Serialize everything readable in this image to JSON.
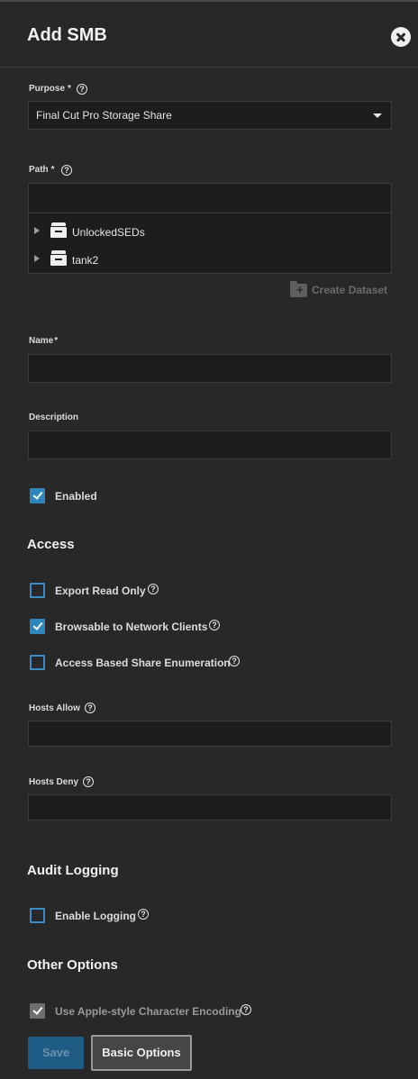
{
  "dialog": {
    "title": "Add SMB"
  },
  "purpose": {
    "label": "Purpose",
    "required_mark": "*",
    "value": "Final Cut Pro Storage Share"
  },
  "path": {
    "label": "Path",
    "required_mark": "*",
    "tree": [
      {
        "name": "UnlockedSEDs",
        "icon": "dataset-icon"
      },
      {
        "name": "tank2",
        "icon": "dataset-icon"
      }
    ],
    "create_dataset_label": "Create Dataset"
  },
  "name": {
    "label": "Name",
    "required_mark": "*",
    "value": ""
  },
  "description": {
    "label": "Description",
    "value": ""
  },
  "enabled": {
    "label": "Enabled",
    "checked": true
  },
  "access": {
    "heading": "Access",
    "export_read_only": {
      "label": "Export Read Only",
      "checked": false
    },
    "browsable": {
      "label": "Browsable to Network Clients",
      "checked": true
    },
    "abe": {
      "label": "Access Based Share Enumeration",
      "checked": false
    },
    "hosts_allow": {
      "label": "Hosts Allow",
      "value": ""
    },
    "hosts_deny": {
      "label": "Hosts Deny",
      "value": ""
    }
  },
  "audit": {
    "heading": "Audit Logging",
    "enable_logging": {
      "label": "Enable Logging",
      "checked": false
    }
  },
  "other": {
    "heading": "Other Options",
    "apple_encoding": {
      "label": "Use Apple-style Character Encoding",
      "checked": true,
      "disabled": true
    }
  },
  "buttons": {
    "save": "Save",
    "basic_options": "Basic Options"
  },
  "help_glyph": "?",
  "colors": {
    "accent": "#2f86bd",
    "background": "#282828",
    "input_bg": "#1d1d1d"
  }
}
